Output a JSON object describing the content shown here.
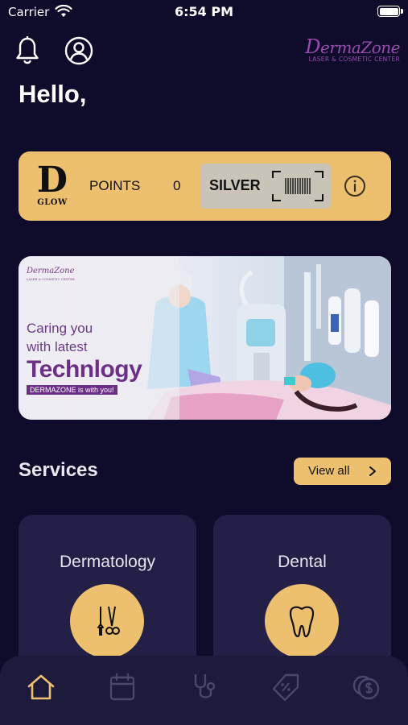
{
  "status_bar": {
    "carrier": "Carrier",
    "time": "6:54 PM",
    "icons": [
      "wifi-icon",
      "battery-icon"
    ]
  },
  "header": {
    "icons": [
      "bell-icon",
      "user-icon"
    ],
    "brand": {
      "name_first": "D",
      "name_rest": "ermaZone",
      "subtitle": "LASER & COSMETIC CENTER"
    }
  },
  "greeting": "Hello,",
  "points_card": {
    "logo_letter": "D",
    "logo_text": "GLOW",
    "points_label": "POINTS",
    "points_value": "0",
    "tier": "SILVER",
    "icons": [
      "barcode-icon",
      "info-icon"
    ]
  },
  "banner": {
    "logo": "DermaZone",
    "logo_sub": "LASER & COSMETIC CENTER",
    "line1": "Caring you",
    "line2": "with latest",
    "headline": "Technlogy",
    "tag": "DERMAZONE is with you!"
  },
  "services": {
    "title": "Services",
    "view_all": "View all",
    "items": [
      {
        "label": "Dermatology",
        "icon": "surgical-tools-icon"
      },
      {
        "label": "Dental",
        "icon": "tooth-icon"
      }
    ]
  },
  "tab_bar": {
    "tabs": [
      {
        "icon": "home-icon",
        "active": true
      },
      {
        "icon": "calendar-icon",
        "active": false
      },
      {
        "icon": "stethoscope-icon",
        "active": false
      },
      {
        "icon": "offer-tag-icon",
        "active": false
      },
      {
        "icon": "coins-icon",
        "active": false
      }
    ]
  },
  "colors": {
    "background": "#0f0b2a",
    "accent": "#ecc06f",
    "card": "#231f47",
    "tab_bar": "#1d1a3c",
    "inactive_icon": "#4a466c",
    "brand": "#9a4bb0"
  }
}
